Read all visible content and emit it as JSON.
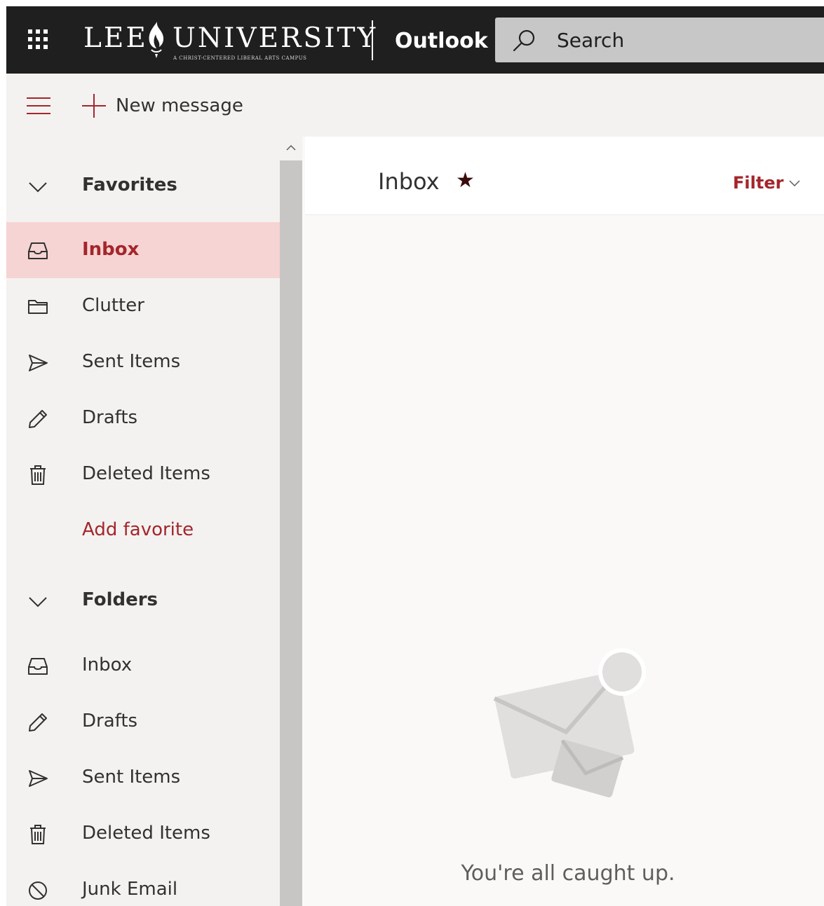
{
  "topbar": {
    "app_launcher_icon": "waffle-grid-icon",
    "logo": {
      "word_left": "LEE",
      "word_right": "UNIVERSITY",
      "tagline": "A CHRIST-CENTERED LIBERAL ARTS CAMPUS"
    },
    "app_name": "Outlook",
    "search": {
      "icon": "search-icon",
      "placeholder": "Search"
    }
  },
  "command_bar": {
    "menu_icon": "hamburger-icon",
    "new_message": {
      "icon": "plus-icon",
      "label": "New message"
    }
  },
  "nav": {
    "favorites": {
      "label": "Favorites",
      "items": [
        {
          "label": "Inbox",
          "icon": "inbox-icon",
          "selected": true
        },
        {
          "label": "Clutter",
          "icon": "folder-icon"
        },
        {
          "label": "Sent Items",
          "icon": "send-icon"
        },
        {
          "label": "Drafts",
          "icon": "pencil-icon"
        },
        {
          "label": "Deleted Items",
          "icon": "trash-icon"
        }
      ],
      "add_favorite": "Add favorite"
    },
    "folders": {
      "label": "Folders",
      "items": [
        {
          "label": "Inbox",
          "icon": "inbox-icon"
        },
        {
          "label": "Drafts",
          "icon": "pencil-icon"
        },
        {
          "label": "Sent Items",
          "icon": "send-icon"
        },
        {
          "label": "Deleted Items",
          "icon": "trash-icon"
        },
        {
          "label": "Junk Email",
          "icon": "block-icon"
        }
      ]
    }
  },
  "main": {
    "title": "Inbox",
    "favorite_star": "★",
    "filter_label": "Filter",
    "empty_message": "You're all caught up."
  },
  "colors": {
    "accent": "#a4262c",
    "topbar_bg": "#1f1f1f",
    "selected_bg": "#f5d4d3"
  }
}
